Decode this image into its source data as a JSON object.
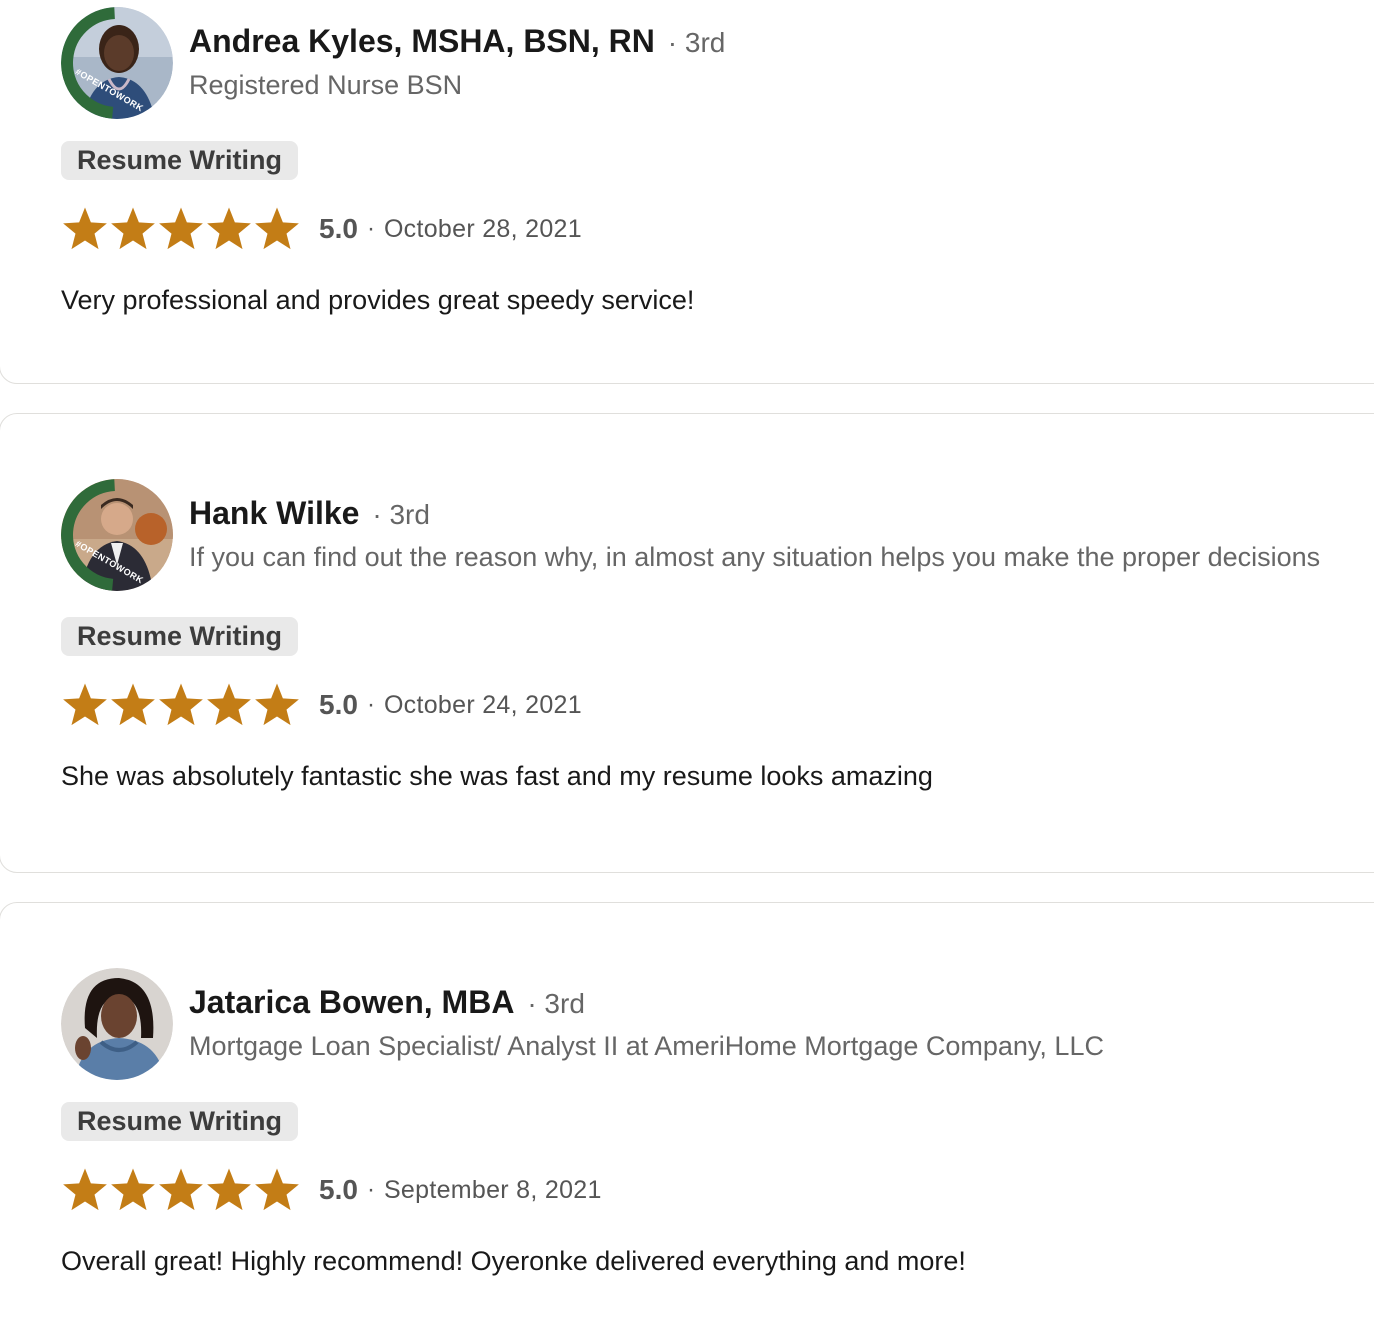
{
  "reviews": [
    {
      "name": "Andrea Kyles, MSHA, BSN, RN",
      "degree": "3rd",
      "headline": "Registered Nurse BSN",
      "service": "Resume Writing",
      "stars_filled": 5,
      "score": "5.0",
      "date": "October 28, 2021",
      "text": "Very professional and provides great speedy service!",
      "open_to_work_badge": "#OPENTOWORK",
      "avatar_colors": {
        "bg": "#a9b7c8",
        "skin": "#5b3b2a",
        "cloth": "#2e4d7a",
        "ring": "#2f6b3a"
      }
    },
    {
      "name": "Hank Wilke",
      "degree": "3rd",
      "headline": "If you can find out the reason why, in almost any situation helps you make the proper decisions",
      "service": "Resume Writing",
      "stars_filled": 5,
      "score": "5.0",
      "date": "October 24, 2021",
      "text": "She was absolutely fantastic she was fast and my resume looks amazing",
      "open_to_work_badge": "#OPENTOWORK",
      "avatar_colors": {
        "bg": "#c9a98a",
        "skin": "#d6a98a",
        "cloth": "#2b2b35",
        "ring": "#2f6b3a"
      }
    },
    {
      "name": "Jatarica Bowen, MBA",
      "degree": "3rd",
      "headline": "Mortgage Loan Specialist/ Analyst II at AmeriHome Mortgage Company, LLC",
      "service": "Resume Writing",
      "stars_filled": 5,
      "score": "5.0",
      "date": "September 8, 2021",
      "text": "Overall great! Highly recommend! Oyeronke delivered everything and more!",
      "avatar_colors": {
        "bg": "#d8d4d0",
        "skin": "#6a4330",
        "cloth": "#5a7ea8",
        "ring": ""
      }
    }
  ],
  "colors": {
    "star": "#c37d16",
    "separator": "#666666"
  }
}
